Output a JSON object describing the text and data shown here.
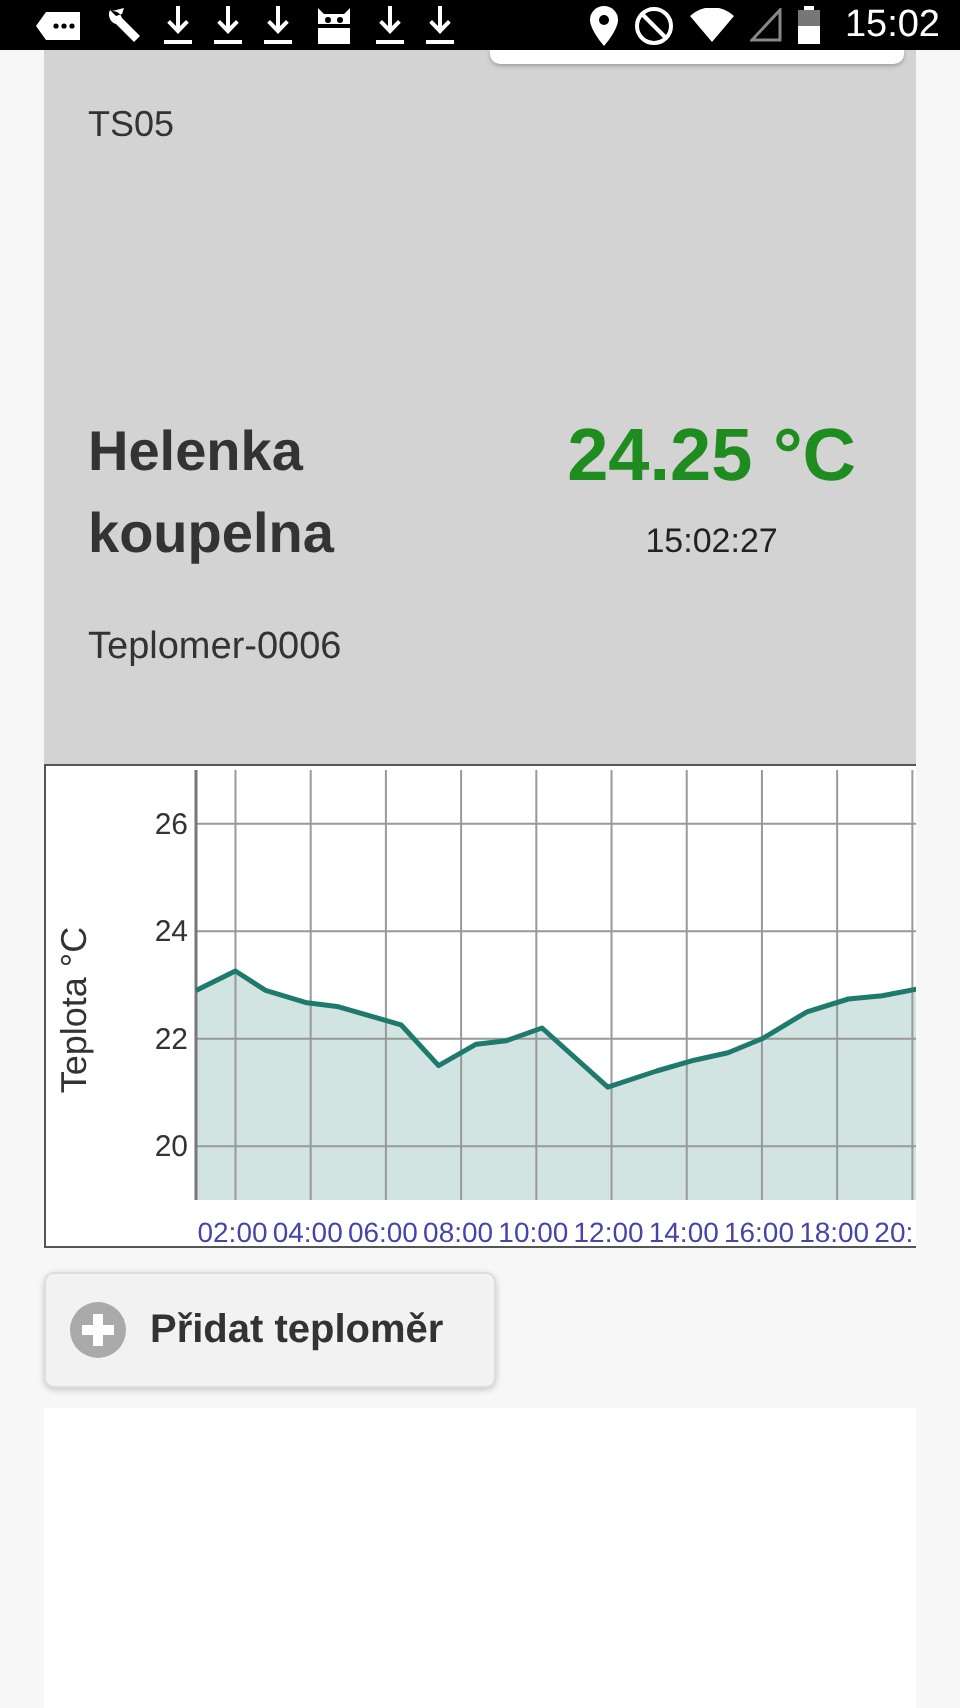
{
  "status_bar": {
    "time": "15:02"
  },
  "sensor_card": {
    "code": "TS05",
    "name": "Helenka koupelna",
    "temperature": "24.25 °C",
    "time": "15:02:27",
    "device": "Teplomer-0006",
    "chart_data": {
      "type": "area",
      "ylabel": "Teplota °C",
      "x": [
        0.95,
        2.0,
        2.8,
        3.9,
        4.7,
        6.4,
        7.4,
        8.4,
        9.2,
        10.15,
        11.9,
        13.2,
        14.2,
        15.1,
        16.0,
        17.2,
        18.3,
        19.2,
        20.15
      ],
      "grid": true,
      "series": [
        {
          "color": "#1f7a6e",
          "values": [
            22.9,
            23.26,
            22.9,
            22.67,
            22.6,
            22.26,
            21.5,
            21.9,
            21.96,
            22.2,
            21.1,
            21.4,
            21.6,
            21.74,
            22.0,
            22.5,
            22.74,
            22.8,
            22.93
          ]
        }
      ],
      "xlim": [
        0.95,
        20.15
      ],
      "ylim": [
        19,
        27
      ],
      "yticks": [
        20,
        22,
        24,
        26
      ],
      "xticks": [
        {
          "value": 2,
          "label": "02:00"
        },
        {
          "value": 4,
          "label": "04:00"
        },
        {
          "value": 6,
          "label": "06:00"
        },
        {
          "value": 8,
          "label": "08:00"
        },
        {
          "value": 10,
          "label": "10:00"
        },
        {
          "value": 12,
          "label": "12:00"
        },
        {
          "value": 14,
          "label": "14:00"
        },
        {
          "value": 16,
          "label": "16:00"
        },
        {
          "value": 18,
          "label": "18:00"
        },
        {
          "value": 20,
          "label": "20:"
        }
      ]
    }
  },
  "add_button": {
    "label": "Přidat teploměr"
  }
}
